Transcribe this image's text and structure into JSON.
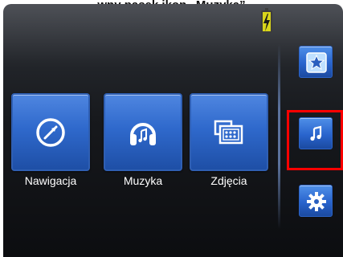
{
  "caption": "…wny pasek ikon „Muzyka”…",
  "status": {
    "battery_icon": "battery-charging-icon"
  },
  "menu": {
    "items": [
      {
        "label": "Nawigacja",
        "icon": "compass-icon"
      },
      {
        "label": "Muzyka",
        "icon": "headphones-icon"
      },
      {
        "label": "Zdjęcia",
        "icon": "photo-folder-icon"
      }
    ]
  },
  "sidebar": {
    "buttons": [
      {
        "icon": "star-icon",
        "state": "normal"
      },
      {
        "icon": "music-note-icon",
        "state": "highlighted"
      },
      {
        "icon": "gear-icon",
        "state": "normal"
      }
    ]
  },
  "colors": {
    "accent_blue": "#2f69cc",
    "highlight_red": "#ff0000",
    "battery_yellow": "#d9d51b"
  }
}
